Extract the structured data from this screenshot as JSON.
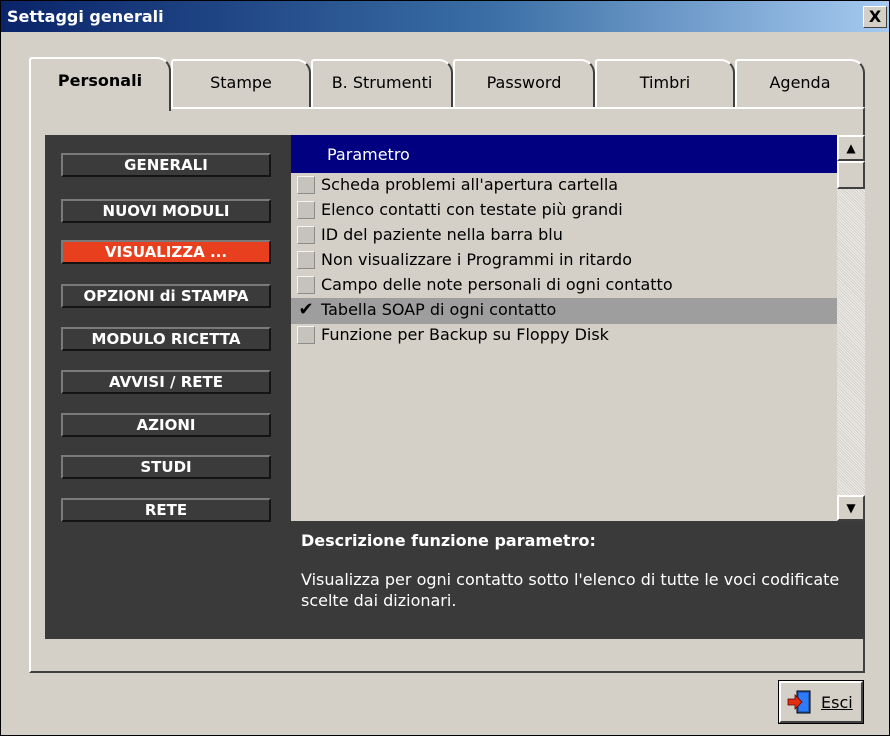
{
  "window": {
    "title": "Settaggi generali",
    "close_label": "X"
  },
  "tabs": [
    {
      "label": "Personali",
      "active": true
    },
    {
      "label": "Stampe",
      "active": false
    },
    {
      "label": "B. Strumenti",
      "active": false
    },
    {
      "label": "Password",
      "active": false
    },
    {
      "label": "Timbri",
      "active": false
    },
    {
      "label": "Agenda",
      "active": false
    }
  ],
  "sidebar": {
    "items": [
      {
        "label": "GENERALI",
        "active": false
      },
      {
        "label": "NUOVI MODULI",
        "active": false
      },
      {
        "label": "VISUALIZZA ...",
        "active": true
      },
      {
        "label": "OPZIONI di STAMPA",
        "active": false
      },
      {
        "label": "MODULO RICETTA",
        "active": false
      },
      {
        "label": "AVVISI / RETE",
        "active": false
      },
      {
        "label": "AZIONI",
        "active": false
      },
      {
        "label": "STUDI",
        "active": false
      },
      {
        "label": "RETE",
        "active": false
      }
    ]
  },
  "list": {
    "header": "Parametro",
    "rows": [
      {
        "label": "Scheda problemi all'apertura cartella",
        "checked": false,
        "selected": false
      },
      {
        "label": "Elenco contatti con testate più grandi",
        "checked": false,
        "selected": false
      },
      {
        "label": "ID del paziente nella barra blu",
        "checked": false,
        "selected": false
      },
      {
        "label": "Non visualizzare i Programmi in ritardo",
        "checked": false,
        "selected": false
      },
      {
        "label": "Campo delle note personali di ogni contatto",
        "checked": false,
        "selected": false
      },
      {
        "label": "Tabella SOAP di ogni contatto",
        "checked": true,
        "selected": true
      },
      {
        "label": "Funzione per Backup su Floppy Disk",
        "checked": false,
        "selected": false
      }
    ],
    "check_mark": "✔"
  },
  "description": {
    "title": "Descrizione funzione parametro:",
    "text": "Visualizza per ogni contatto sotto l'elenco di tutte le voci codificate scelte dai dizionari."
  },
  "footer": {
    "exit_label": "Esci",
    "exit_icon": "exit-door-icon"
  },
  "colors": {
    "title_start": "#0a246a",
    "title_end": "#a6caf0",
    "active_nav": "#e8401e",
    "list_header": "#000080",
    "dark_panel": "#3a3a3a"
  }
}
